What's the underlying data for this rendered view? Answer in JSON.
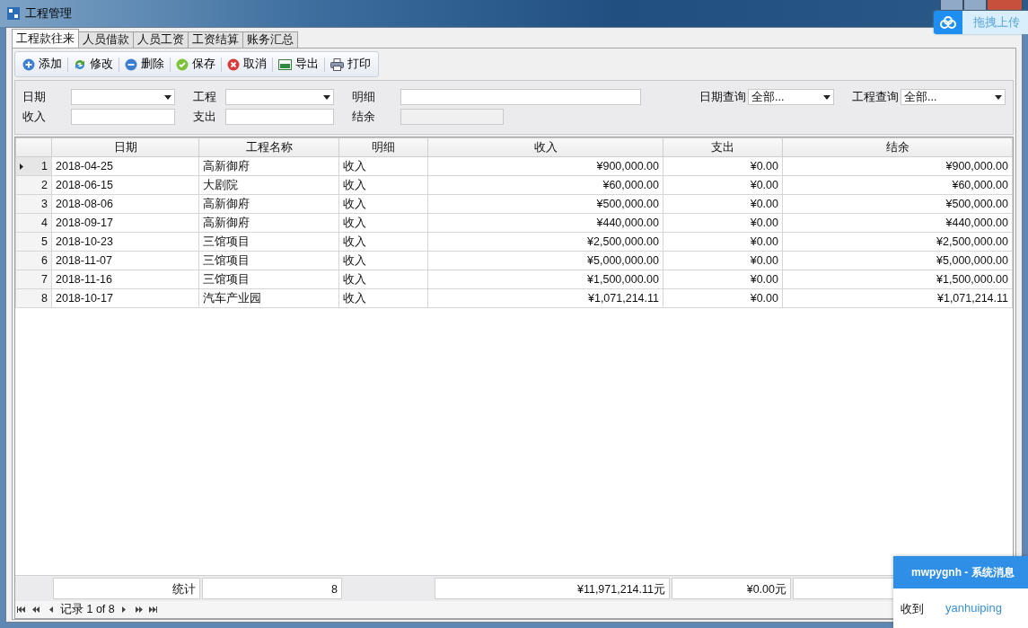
{
  "window": {
    "title": "工程管理"
  },
  "tabs": [
    {
      "label": "工程款往来",
      "selected": true
    },
    {
      "label": "人员借款",
      "selected": false
    },
    {
      "label": "人员工资",
      "selected": false
    },
    {
      "label": "工资结算",
      "selected": false
    },
    {
      "label": "账务汇总",
      "selected": false
    }
  ],
  "toolbar": [
    {
      "label": "添加",
      "kind": "add"
    },
    {
      "label": "修改",
      "kind": "edit"
    },
    {
      "label": "删除",
      "kind": "delete"
    },
    {
      "label": "保存",
      "kind": "save"
    },
    {
      "label": "取消",
      "kind": "cancel"
    },
    {
      "label": "导出",
      "kind": "export"
    },
    {
      "label": "打印",
      "kind": "print"
    }
  ],
  "filters": {
    "date_label": "日期",
    "project_label": "工程",
    "detail_label": "明细",
    "income_label": "收入",
    "expense_label": "支出",
    "balance_label": "结余",
    "date_query_label": "日期查询",
    "date_query_value": "全部...",
    "project_query_label": "工程查询",
    "project_query_value": "全部..."
  },
  "grid": {
    "columns": [
      "日期",
      "工程名称",
      "明细",
      "收入",
      "支出",
      "结余"
    ],
    "rows": [
      {
        "number": "1",
        "selected": true,
        "cells": [
          "2018-04-25",
          "高新御府",
          "收入",
          "¥900,000.00",
          "¥0.00",
          "¥900,000.00"
        ]
      },
      {
        "number": "2",
        "selected": false,
        "cells": [
          "2018-06-15",
          "大剧院",
          "收入",
          "¥60,000.00",
          "¥0.00",
          "¥60,000.00"
        ]
      },
      {
        "number": "3",
        "selected": false,
        "cells": [
          "2018-08-06",
          "高新御府",
          "收入",
          "¥500,000.00",
          "¥0.00",
          "¥500,000.00"
        ]
      },
      {
        "number": "4",
        "selected": false,
        "cells": [
          "2018-09-17",
          "高新御府",
          "收入",
          "¥440,000.00",
          "¥0.00",
          "¥440,000.00"
        ]
      },
      {
        "number": "5",
        "selected": false,
        "cells": [
          "2018-10-23",
          "三馆项目",
          "收入",
          "¥2,500,000.00",
          "¥0.00",
          "¥2,500,000.00"
        ]
      },
      {
        "number": "6",
        "selected": false,
        "cells": [
          "2018-11-07",
          "三馆项目",
          "收入",
          "¥5,000,000.00",
          "¥0.00",
          "¥5,000,000.00"
        ]
      },
      {
        "number": "7",
        "selected": false,
        "cells": [
          "2018-11-16",
          "三馆项目",
          "收入",
          "¥1,500,000.00",
          "¥0.00",
          "¥1,500,000.00"
        ]
      },
      {
        "number": "8",
        "selected": false,
        "cells": [
          "2018-10-17",
          "汽车产业园",
          "收入",
          "¥1,071,214.11",
          "¥0.00",
          "¥1,071,214.11"
        ]
      }
    ]
  },
  "summary": {
    "label": "统计",
    "count": "8",
    "income": "¥11,971,214.11元",
    "expense": "¥0.00元"
  },
  "navigator": {
    "text": "记录 1 of 8"
  },
  "upload_widget": {
    "label": "拖拽上传"
  },
  "notification": {
    "title": "mwpygnh - 系统消息",
    "label": "收到",
    "sender": "yanhuiping"
  }
}
